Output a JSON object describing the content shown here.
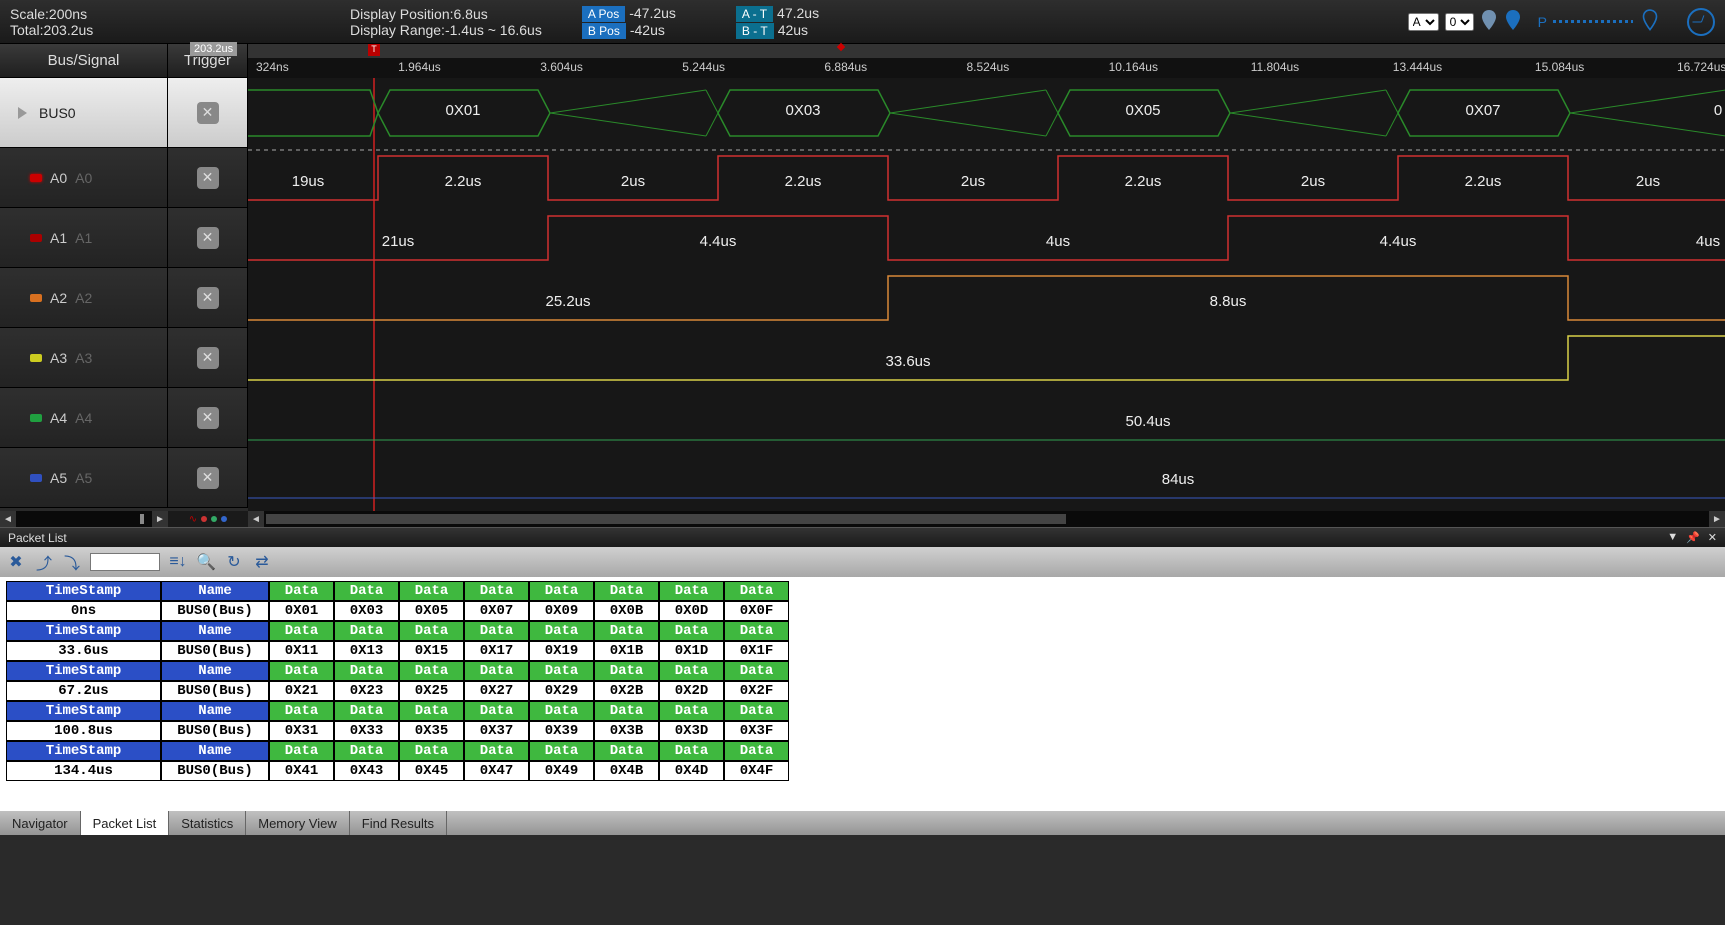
{
  "top": {
    "scale_label": "Scale:",
    "scale_value": "200ns",
    "total_label": "Total:",
    "total_value": "203.2us",
    "disp_pos_label": "Display Position:",
    "disp_pos_value": "6.8us",
    "disp_range_label": "Display Range:",
    "disp_range_value": "-1.4us ~ 16.6us",
    "a_pos_label": "A Pos",
    "a_pos_value": "-47.2us",
    "b_pos_label": "B Pos",
    "b_pos_value": "-42us",
    "a_t_label": "A - T",
    "a_t_value": "47.2us",
    "b_t_label": "B - T",
    "b_t_value": "42us",
    "sel_a": "A",
    "sel_0": "0",
    "p_label": "P"
  },
  "hdr": {
    "bus_signal": "Bus/Signal",
    "trigger": "Trigger",
    "pos_tip": "203.2us"
  },
  "ruler_ticks": [
    "324ns",
    "1.964us",
    "3.604us",
    "5.244us",
    "6.884us",
    "8.524us",
    "10.164us",
    "11.804us",
    "13.444us",
    "15.084us",
    "16.724us"
  ],
  "signals": [
    {
      "name": "BUS0",
      "bus": true
    },
    {
      "name": "A0",
      "sub": "A0",
      "led": "red"
    },
    {
      "name": "A1",
      "sub": "A1",
      "led": "red2"
    },
    {
      "name": "A2",
      "sub": "A2",
      "led": "orange"
    },
    {
      "name": "A3",
      "sub": "A3",
      "led": "yellow"
    },
    {
      "name": "A4",
      "sub": "A4",
      "led": "green"
    },
    {
      "name": "A5",
      "sub": "A5",
      "led": "blue"
    }
  ],
  "bus_values": [
    "0X01",
    "0X03",
    "0X05",
    "0X07",
    "0"
  ],
  "a0_labels": [
    "19us",
    "2.2us",
    "2us",
    "2.2us",
    "2us",
    "2.2us",
    "2us",
    "2.2us",
    "2us"
  ],
  "a1_labels": [
    "21us",
    "4.4us",
    "4us",
    "4.4us",
    "4us"
  ],
  "a2_labels": [
    "25.2us",
    "8.8us"
  ],
  "a3_label": "33.6us",
  "a4_label": "50.4us",
  "a5_label": "84us",
  "packet_panel_title": "Packet List",
  "packet_headers": [
    "TimeStamp",
    "Name",
    "Data",
    "Data",
    "Data",
    "Data",
    "Data",
    "Data",
    "Data",
    "Data"
  ],
  "packets": [
    {
      "ts": "0ns",
      "name": "BUS0(Bus)",
      "data": [
        "0X01",
        "0X03",
        "0X05",
        "0X07",
        "0X09",
        "0X0B",
        "0X0D",
        "0X0F"
      ]
    },
    {
      "ts": "33.6us",
      "name": "BUS0(Bus)",
      "data": [
        "0X11",
        "0X13",
        "0X15",
        "0X17",
        "0X19",
        "0X1B",
        "0X1D",
        "0X1F"
      ]
    },
    {
      "ts": "67.2us",
      "name": "BUS0(Bus)",
      "data": [
        "0X21",
        "0X23",
        "0X25",
        "0X27",
        "0X29",
        "0X2B",
        "0X2D",
        "0X2F"
      ]
    },
    {
      "ts": "100.8us",
      "name": "BUS0(Bus)",
      "data": [
        "0X31",
        "0X33",
        "0X35",
        "0X37",
        "0X39",
        "0X3B",
        "0X3D",
        "0X3F"
      ]
    },
    {
      "ts": "134.4us",
      "name": "BUS0(Bus)",
      "data": [
        "0X41",
        "0X43",
        "0X45",
        "0X47",
        "0X49",
        "0X4B",
        "0X4D",
        "0X4F"
      ]
    }
  ],
  "bottom_tabs": [
    "Navigator",
    "Packet List",
    "Statistics",
    "Memory View",
    "Find Results"
  ]
}
